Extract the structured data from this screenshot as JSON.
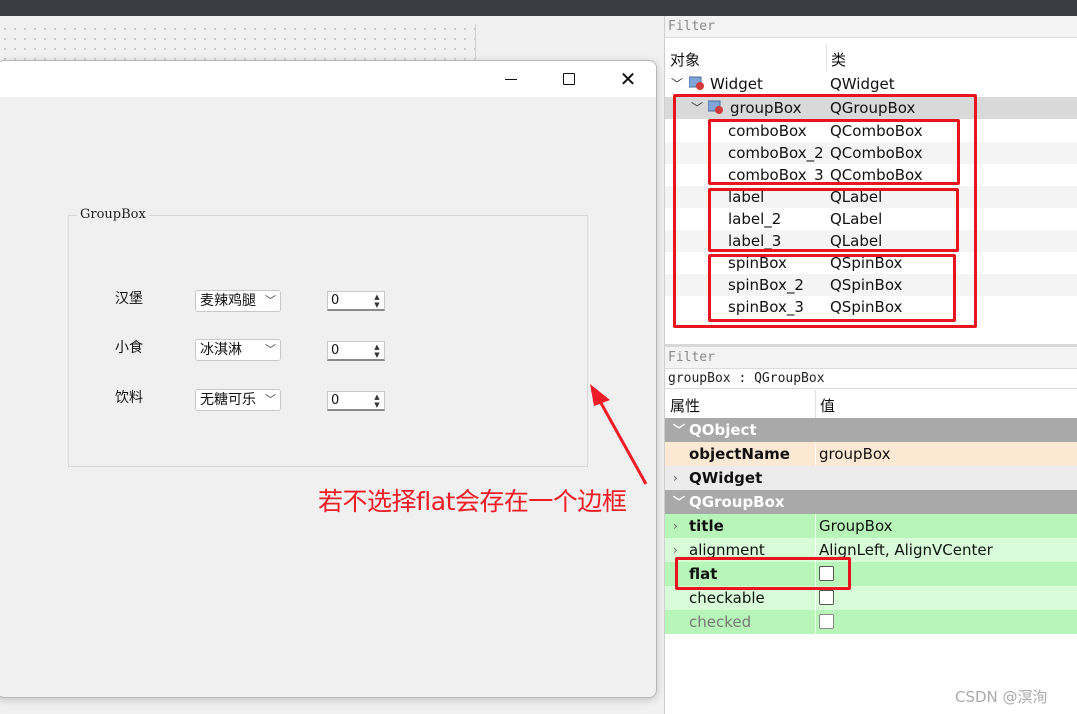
{
  "preview": {
    "group_title": "GroupBox",
    "rows": [
      {
        "label": "汉堡",
        "combo": "麦辣鸡腿",
        "spin": "0"
      },
      {
        "label": "小食",
        "combo": "冰淇淋",
        "spin": "0"
      },
      {
        "label": "饮料",
        "combo": "无糖可乐",
        "spin": "0"
      }
    ]
  },
  "annotation": "若不选择flat会存在一个边框",
  "object_inspector": {
    "filter_placeholder": "Filter",
    "col_object": "对象",
    "col_class": "类",
    "items": [
      {
        "name": "Widget",
        "cls": "QWidget"
      },
      {
        "name": "groupBox",
        "cls": "QGroupBox"
      },
      {
        "name": "comboBox",
        "cls": "QComboBox"
      },
      {
        "name": "comboBox_2",
        "cls": "QComboBox"
      },
      {
        "name": "comboBox_3",
        "cls": "QComboBox"
      },
      {
        "name": "label",
        "cls": "QLabel"
      },
      {
        "name": "label_2",
        "cls": "QLabel"
      },
      {
        "name": "label_3",
        "cls": "QLabel"
      },
      {
        "name": "spinBox",
        "cls": "QSpinBox"
      },
      {
        "name": "spinBox_2",
        "cls": "QSpinBox"
      },
      {
        "name": "spinBox_3",
        "cls": "QSpinBox"
      }
    ]
  },
  "property_editor": {
    "filter_placeholder": "Filter",
    "object_line": "groupBox : QGroupBox",
    "col_property": "属性",
    "col_value": "值",
    "rows": {
      "qobject": "QObject",
      "objectName_k": "objectName",
      "objectName_v": "groupBox",
      "qwidget": "QWidget",
      "qgroupbox": "QGroupBox",
      "title_k": "title",
      "title_v": "GroupBox",
      "alignment_k": "alignment",
      "alignment_v": "AlignLeft, AlignVCenter",
      "flat_k": "flat",
      "checkable_k": "checkable",
      "checked_k": "checked"
    }
  },
  "watermark": "CSDN @溟洵",
  "colors": {
    "highlight": "#e8151f",
    "annotation": "#ee1c25"
  }
}
